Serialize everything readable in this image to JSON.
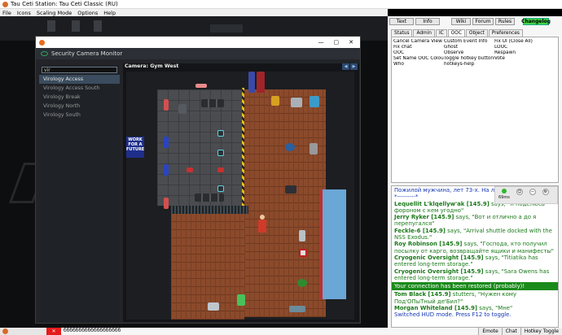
{
  "window": {
    "title": "Tau Ceti Station: Tau Ceti Classic (RU)"
  },
  "menu": [
    "File",
    "Icons",
    "Scaling Mode",
    "Options",
    "Help"
  ],
  "top_tabs": [
    "Text",
    "Info",
    "Wiki",
    "Forum",
    "Rules",
    "Changelog"
  ],
  "panel_tabs": [
    "Status",
    "Admin",
    "IC",
    "OOC",
    "Object",
    "Preferences"
  ],
  "verbs": [
    [
      "Cancel Camera View",
      "Custom Event Info",
      "Fix UI (Close All)"
    ],
    [
      "Fix chat",
      "Ghost",
      "LOOC"
    ],
    [
      "OOC",
      "Observe",
      "Respawn"
    ],
    [
      "Set Name OOC Colour",
      "Toggle hotkey buttons",
      "Vote"
    ],
    [
      "Who",
      "hotkeys-help",
      ""
    ]
  ],
  "ping": "69ms",
  "camera_window": {
    "title": "Security Camera Monitor",
    "camera_label": "Camera: Gym West",
    "search_value": "vir",
    "cameras": [
      {
        "name": "Virology Access",
        "selected": true
      },
      {
        "name": "Virology Access South",
        "selected": false
      },
      {
        "name": "Virology Break",
        "selected": false
      },
      {
        "name": "Virology North",
        "selected": false
      },
      {
        "name": "Virology South",
        "selected": false
      }
    ],
    "sign_text": "WORK FOR A FUTURE"
  },
  "chat": {
    "top": "Пожилой мужчина, лет 73-х. На лице п...",
    "top2": "*---------*",
    "lines": [
      {
        "name": "Lequellit L'klqellyw'ak [145.9]",
        "verb": "says,",
        "text": "\"Я поделюсь фороном с кем угодно\""
      },
      {
        "name": "Jerry Ryker [145.9]",
        "verb": "says,",
        "text": "\"Вот и отлично а до я перепугался\""
      },
      {
        "name": "Feckle-6 [145.9]",
        "verb": "says,",
        "text": "\"Arrival shuttle docked with the NSS Exodus.\""
      },
      {
        "name": "Roy Robinson [145.9]",
        "verb": "says,",
        "text": "\"Господа, кто получил посылку от карго, возвращайте ящики и манифесты\""
      },
      {
        "name": "Cryogenic Oversight [145.9]",
        "verb": "says,",
        "text": "\"Titiatika has entered long-term storage.\""
      },
      {
        "name": "Cryogenic Oversight [145.9]",
        "verb": "says,",
        "text": "\"Sara Owens has entered long-term storage.\""
      }
    ],
    "banner": "Your connection has been restored (probably)!",
    "after": [
      {
        "name": "Tom Black [145.9]",
        "verb": "stutters,",
        "text": "\"Нужен кому Под'ОПыТный де'Бил?\""
      },
      {
        "name": "Morgan Whiteland [145.9]",
        "verb": "says,",
        "text": "\"Мне\""
      }
    ],
    "hud": "Switched HUD mode. Press F12 to toggle."
  },
  "taskbar": {
    "input": "ббббббббббббббббббб",
    "buttons": [
      "Emote",
      "Chat",
      "Hotkey Toggle"
    ]
  },
  "colors": {
    "changelog": "#3fd447",
    "chat_name": "#1a7a1a",
    "banner": "#1a8a1a"
  }
}
